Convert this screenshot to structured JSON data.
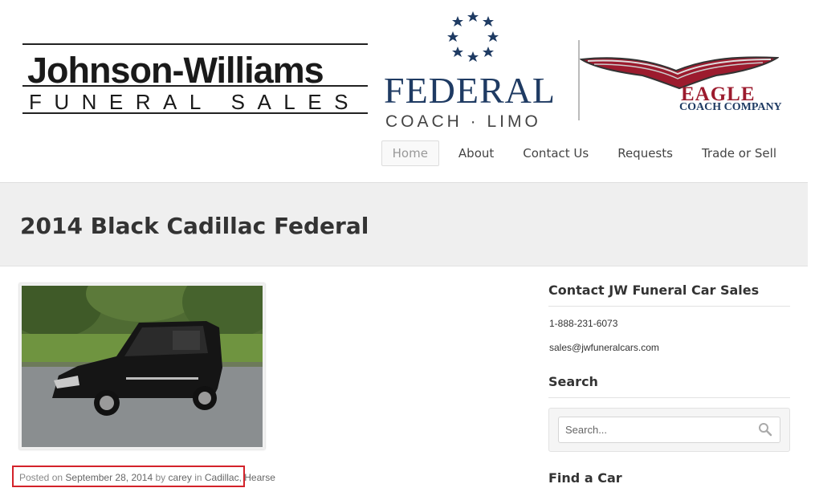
{
  "header": {
    "logo_jw": {
      "name": "Johnson-Williams",
      "sub": "FUNERAL SALES"
    },
    "logo_federal": {
      "name": "FEDERAL",
      "sub": "COACH · LIMO"
    },
    "logo_eagle": {
      "name": "EAGLE",
      "sub": "COACH COMPANY"
    }
  },
  "nav": {
    "items": [
      {
        "label": "Home",
        "active": true
      },
      {
        "label": "About"
      },
      {
        "label": "Contact Us"
      },
      {
        "label": "Requests"
      },
      {
        "label": "Trade or Sell"
      }
    ]
  },
  "page": {
    "title": "2014 Black Cadillac Federal"
  },
  "post": {
    "image_alt": "black-hearse-photo",
    "meta": {
      "posted_on": "Posted on",
      "date": "September 28, 2014",
      "by": "by",
      "author": "carey",
      "in": "in",
      "category1": "Cadillac",
      "separator": ",",
      "category2": "Hearse"
    }
  },
  "sidebar": {
    "contact": {
      "title": "Contact JW Funeral Car Sales",
      "phone": "1-888-231-6073",
      "email": "sales@jwfuneralcars.com"
    },
    "search": {
      "title": "Search",
      "placeholder": "Search...",
      "icon": "search-icon"
    },
    "find": {
      "title": "Find a Car"
    }
  },
  "colors": {
    "highlight_box": "#d3222a",
    "federal_blue": "#1f3b63",
    "eagle_red": "#9c1b2e",
    "title_band": "#efefef"
  }
}
